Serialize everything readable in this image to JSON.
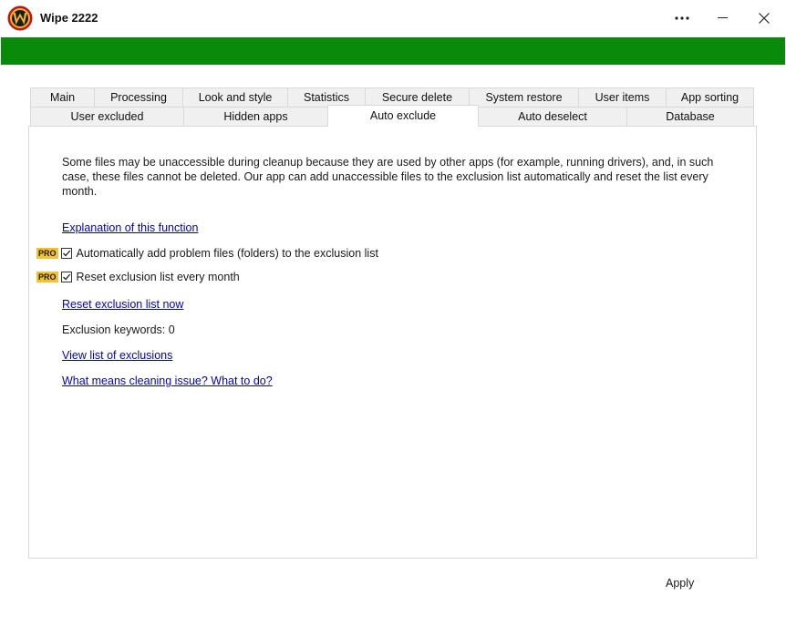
{
  "window": {
    "title": "Wipe 2222",
    "logo_letter": "W"
  },
  "tabs_row1": [
    {
      "label": "Main"
    },
    {
      "label": "Processing"
    },
    {
      "label": "Look and style"
    },
    {
      "label": "Statistics"
    },
    {
      "label": "Secure delete"
    },
    {
      "label": "System restore"
    },
    {
      "label": "User items"
    },
    {
      "label": "App sorting"
    }
  ],
  "tabs_row2": [
    {
      "label": "User excluded"
    },
    {
      "label": "Hidden apps"
    },
    {
      "label": "Auto exclude",
      "active": true
    },
    {
      "label": "Auto deselect"
    },
    {
      "label": "Database"
    }
  ],
  "panel": {
    "description": "Some files may be unaccessible during cleanup because they are used by other apps (for example, running drivers), and, in such case, these files cannot be deleted. Our app can add unaccessible files to the exclusion list automatically and reset the list every month.",
    "explanation_link": "Explanation of this function",
    "options": [
      {
        "badge": "PRO",
        "label": "Automatically add problem files (folders) to the exclusion list",
        "checked": true
      },
      {
        "badge": "PRO",
        "label": "Reset exclusion list every month",
        "checked": true
      }
    ],
    "reset_link": "Reset exclusion list now",
    "keywords_text": "Exclusion keywords: 0",
    "view_link": "View list of exclusions",
    "issue_link": "What means cleaning issue? What to do?"
  },
  "footer": {
    "apply_label": "Apply"
  },
  "colors": {
    "accent_green": "#0a8a0a",
    "link_blue": "#0000cc",
    "pro_badge": "#f2c230"
  }
}
